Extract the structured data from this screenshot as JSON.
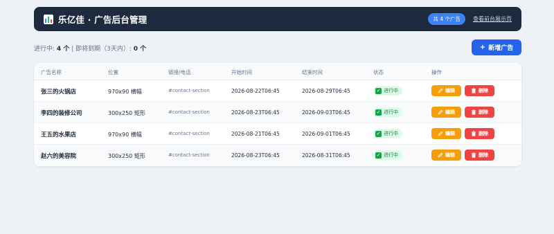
{
  "header": {
    "title": "乐亿佳 · 广告后台管理",
    "count_badge": "共 4 个广告",
    "front_link": "查看前台展示页"
  },
  "stats": {
    "active_label": "进行中:",
    "active_count": "4 个",
    "separator": "|",
    "expiring_label": "即将到期（3天内）:",
    "expiring_count": "0 个"
  },
  "add_button": {
    "plus": "+",
    "label": "新增广告"
  },
  "table": {
    "columns": [
      "广告名称",
      "位置",
      "链接/电话",
      "开始时间",
      "结束时间",
      "状态",
      "操作"
    ],
    "rows": [
      {
        "name": "张三的火锅店",
        "position": "970x90 横幅",
        "link": "#contact-section",
        "start": "2026-08-22T06:45",
        "end": "2026-08-29T06:45",
        "status": "进行中",
        "edit": "编辑",
        "delete": "删除"
      },
      {
        "name": "李四的装修公司",
        "position": "300x250 矩形",
        "link": "#contact-section",
        "start": "2026-08-23T06:45",
        "end": "2026-09-03T06:45",
        "status": "进行中",
        "edit": "编辑",
        "delete": "删除"
      },
      {
        "name": "王五的水果店",
        "position": "970x90 横幅",
        "link": "#contact-section",
        "start": "2026-08-21T06:45",
        "end": "2026-09-01T06:45",
        "status": "进行中",
        "edit": "编辑",
        "delete": "删除"
      },
      {
        "name": "赵六的美容院",
        "position": "300x250 矩形",
        "link": "#contact-section",
        "start": "2026-08-23T06:45",
        "end": "2026-08-31T06:45",
        "status": "进行中",
        "edit": "编辑",
        "delete": "删除"
      }
    ]
  },
  "icons": {
    "logo": "bar-chart-icon",
    "status": "check-icon",
    "edit": "pencil-icon",
    "delete": "trash-icon"
  },
  "colors": {
    "header_bg": "#1e2a3e",
    "primary": "#2563eb",
    "badge": "#3b82f6",
    "edit": "#f59e0b",
    "delete": "#ef4444",
    "status_bg": "#dcfce7",
    "status_text": "#15803d"
  }
}
